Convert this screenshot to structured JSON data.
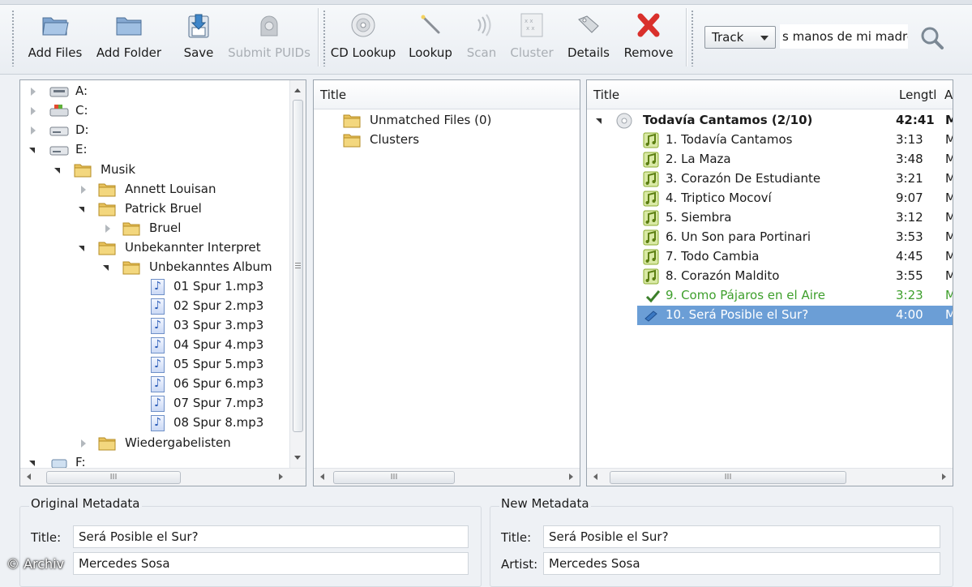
{
  "toolbar": {
    "add_files": "Add Files",
    "add_folder": "Add Folder",
    "save": "Save",
    "submit_puids": "Submit PUIDs",
    "cd_lookup": "CD Lookup",
    "lookup": "Lookup",
    "scan": "Scan",
    "cluster": "Cluster",
    "details": "Details",
    "remove": "Remove",
    "search_type": "Track",
    "search_value": "s manos de mi madre"
  },
  "tree": {
    "drives": [
      {
        "label": "A:"
      },
      {
        "label": "C:"
      },
      {
        "label": "D:"
      },
      {
        "label": "E:"
      }
    ],
    "musik": "Musik",
    "annett": "Annett Louisan",
    "patrick": "Patrick Bruel",
    "bruel": "Bruel",
    "unbekannter": "Unbekannter Interpret",
    "album": "Unbekanntes Album",
    "files": [
      "01 Spur 1.mp3",
      "02 Spur 2.mp3",
      "03 Spur 3.mp3",
      "04 Spur 4.mp3",
      "05 Spur 5.mp3",
      "06 Spur 6.mp3",
      "07 Spur 7.mp3",
      "08 Spur 8.mp3"
    ],
    "wiedergabelisten": "Wiedergabelisten",
    "f_drive": "F:"
  },
  "middle": {
    "header": "Title",
    "items": [
      "Unmatched Files (0)",
      "Clusters"
    ]
  },
  "right": {
    "header_title": "Title",
    "header_length": "Lengtl",
    "header_extra": "A",
    "album_title": "Todavía Cantamos (2/10)",
    "album_length": "42:41",
    "album_extra": "M",
    "tracks": [
      {
        "title": "1. Todavía Cantamos",
        "length": "3:13",
        "extra": "M"
      },
      {
        "title": "2. La Maza",
        "length": "3:48",
        "extra": "M"
      },
      {
        "title": "3. Corazón De Estudiante",
        "length": "3:21",
        "extra": "M"
      },
      {
        "title": "4. Triptico Mocoví",
        "length": "9:07",
        "extra": "M"
      },
      {
        "title": "5. Siembra",
        "length": "3:12",
        "extra": "M"
      },
      {
        "title": "6. Un Son para Portinari",
        "length": "3:53",
        "extra": "M"
      },
      {
        "title": "7. Todo Cambia",
        "length": "4:45",
        "extra": "M"
      },
      {
        "title": "8. Corazón Maldito",
        "length": "3:55",
        "extra": "M"
      },
      {
        "title": "9. Como Pájaros en el Aire",
        "length": "3:23",
        "extra": "M"
      },
      {
        "title": "10. Será Posible el Sur?",
        "length": "4:00",
        "extra": "M"
      }
    ]
  },
  "scroll_thumb": "III",
  "original": {
    "heading": "Original Metadata",
    "title_label": "Title:",
    "title_value": "Será Posible el Sur?",
    "artist_value": "Mercedes Sosa"
  },
  "newmeta": {
    "heading": "New Metadata",
    "title_label": "Title:",
    "title_value": "Será Posible el Sur?",
    "artist_label": "Artist:",
    "artist_value": "Mercedes Sosa"
  },
  "watermark": "© Archiv",
  "colors": {
    "selection": "#6b9ed6",
    "matched_green": "#3e9f2c",
    "remove_red": "#d9302c"
  }
}
